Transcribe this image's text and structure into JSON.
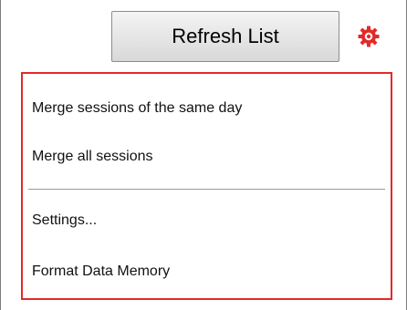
{
  "toolbar": {
    "refresh_label": "Refresh List",
    "settings_icon": "gear-icon",
    "accent_color": "#e32a2a"
  },
  "menu": {
    "items": [
      {
        "label": "Merge sessions of the same day"
      },
      {
        "label": "Merge all sessions"
      },
      {
        "label": "Settings..."
      },
      {
        "label": "Format Data Memory"
      }
    ]
  }
}
